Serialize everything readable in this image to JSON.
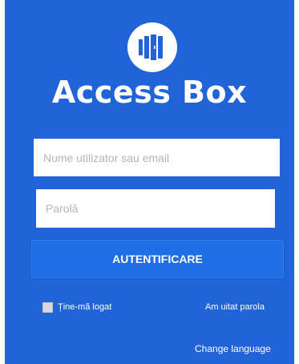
{
  "app": {
    "title": "Access Box",
    "logo_icon": "door-panels-icon"
  },
  "form": {
    "username_placeholder": "Nume utilizator sau email",
    "username_value": "",
    "password_placeholder": "Parolă",
    "password_value": "",
    "login_label": "AUTENTIFICARE",
    "remember_label": "Ține-mă logat",
    "remember_checked": false,
    "forgot_password_label": "Am uitat parola",
    "change_language_label": "Change language"
  },
  "colors": {
    "panel_background": "#2064d8",
    "button_background": "#1f6ee6",
    "text_on_brand": "#ffffff",
    "logo_icon_color": "#2064d8"
  }
}
